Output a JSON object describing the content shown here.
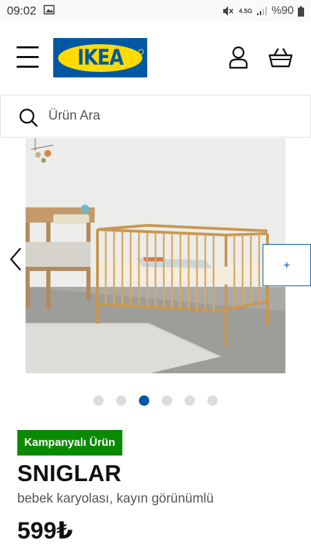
{
  "status_bar": {
    "time": "09:02",
    "network": "4.5G",
    "battery": "%90"
  },
  "header": {
    "logo_text": "IKEA",
    "icons": [
      "menu-icon",
      "account-icon",
      "shopping-basket-icon"
    ]
  },
  "search": {
    "placeholder": "Ürün Ara"
  },
  "carousel": {
    "next_label": "+",
    "dot_count": 6,
    "active_dot_index": 2
  },
  "product": {
    "badge": "Kampanyalı Ürün",
    "name": "SNIGLAR",
    "description": "bebek karyolası, kayın görünümlü",
    "price": "599₺"
  },
  "colors": {
    "brand_blue": "#0058a3",
    "brand_yellow": "#ffdb00",
    "badge_green": "#0a8a00"
  }
}
